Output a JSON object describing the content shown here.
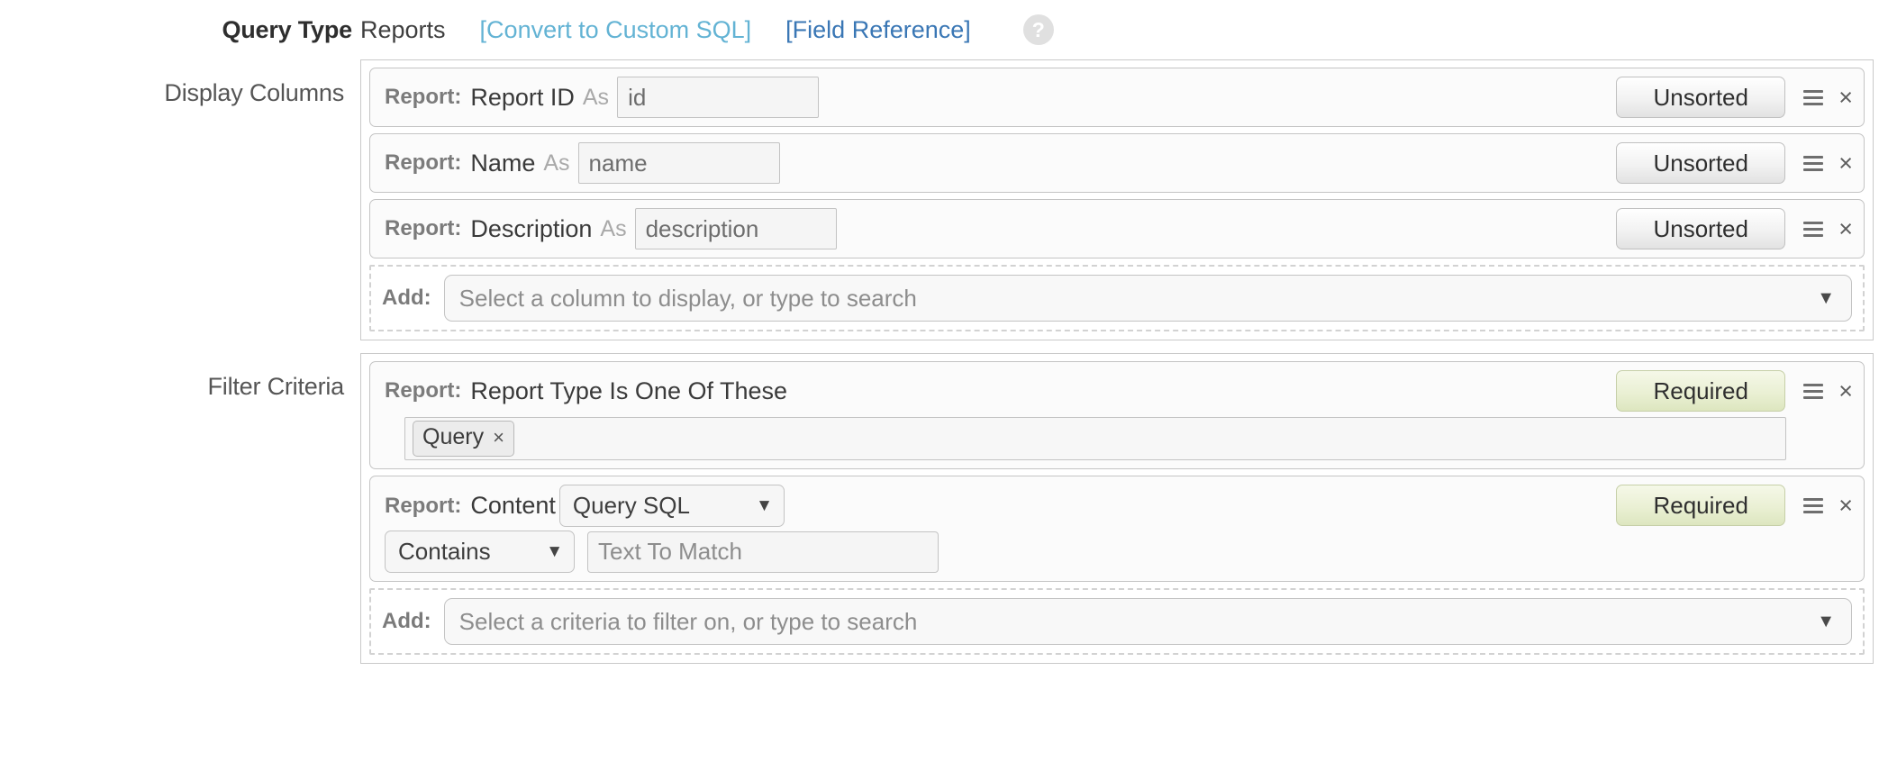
{
  "header": {
    "label": "Query Type",
    "value": "Reports",
    "convert_link": "[Convert to Custom SQL]",
    "field_reference_link": "[Field Reference]",
    "help_icon": "?",
    "link_colors": {
      "convert": "#63b3d4",
      "field_reference": "#3a77b5"
    }
  },
  "display_columns": {
    "label": "Display Columns",
    "rows": [
      {
        "prefix": "Report:",
        "field": "Report ID",
        "as_word": "As",
        "alias": "id",
        "sort_state": "Unsorted",
        "handle_icon": "drag-handle-icon",
        "remove_icon": "×"
      },
      {
        "prefix": "Report:",
        "field": "Name",
        "as_word": "As",
        "alias": "name",
        "sort_state": "Unsorted",
        "handle_icon": "drag-handle-icon",
        "remove_icon": "×"
      },
      {
        "prefix": "Report:",
        "field": "Description",
        "as_word": "As",
        "alias": "description",
        "sort_state": "Unsorted",
        "handle_icon": "drag-handle-icon",
        "remove_icon": "×"
      }
    ],
    "add": {
      "label": "Add:",
      "placeholder": "Select a column to display, or type to search",
      "caret": "▼"
    }
  },
  "filter_criteria": {
    "label": "Filter Criteria",
    "rows": [
      {
        "prefix": "Report:",
        "field": "Report Type Is One Of These",
        "tokens": [
          {
            "label": "Query",
            "remove": "×"
          }
        ],
        "state": "Required",
        "handle_icon": "drag-handle-icon",
        "remove_icon": "×"
      },
      {
        "prefix": "Report:",
        "field": "Content",
        "content_select": "Query SQL",
        "content_caret": "▼",
        "operator_select": "Contains",
        "operator_caret": "▼",
        "match_placeholder": "Text To Match",
        "match_value": "",
        "state": "Required",
        "handle_icon": "drag-handle-icon",
        "remove_icon": "×"
      }
    ],
    "add": {
      "label": "Add:",
      "placeholder": "Select a criteria to filter on, or type to search",
      "caret": "▼"
    }
  }
}
